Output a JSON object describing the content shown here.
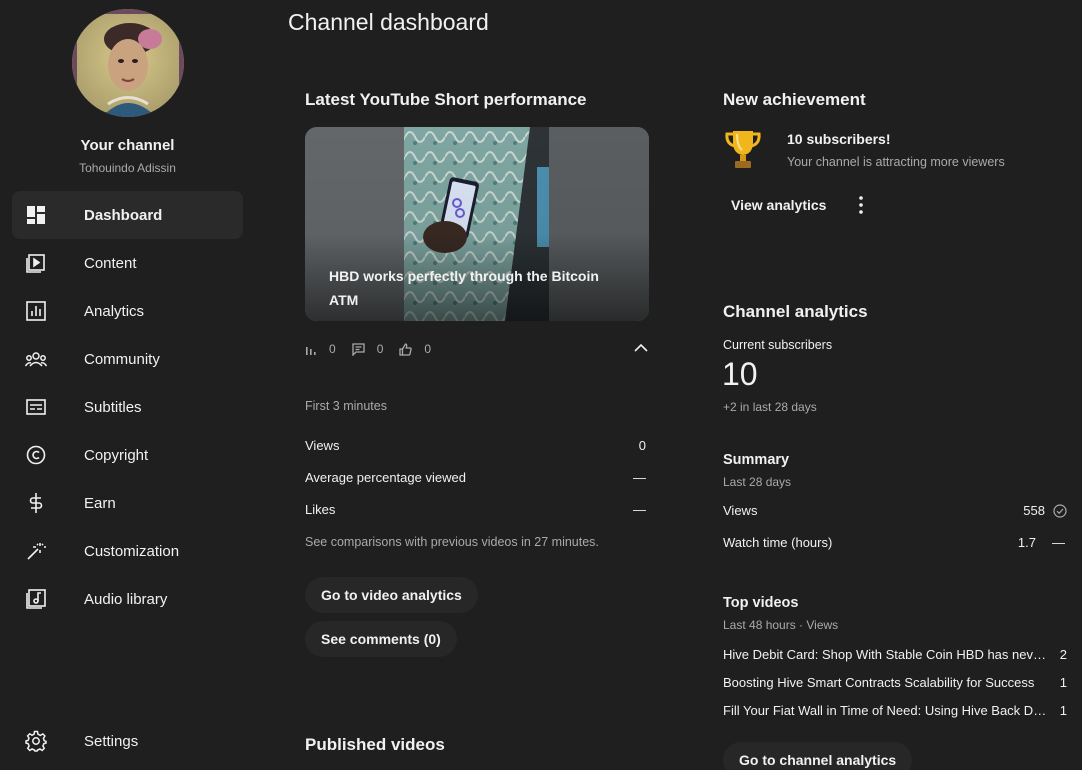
{
  "sidebar": {
    "channel_title": "Your channel",
    "channel_name": "Tohouindo Adissin",
    "items": [
      {
        "label": "Dashboard",
        "icon": "dashboard-icon"
      },
      {
        "label": "Content",
        "icon": "content-icon"
      },
      {
        "label": "Analytics",
        "icon": "analytics-icon"
      },
      {
        "label": "Community",
        "icon": "community-icon"
      },
      {
        "label": "Subtitles",
        "icon": "subtitles-icon"
      },
      {
        "label": "Copyright",
        "icon": "copyright-icon"
      },
      {
        "label": "Earn",
        "icon": "earn-icon"
      },
      {
        "label": "Customization",
        "icon": "customization-icon"
      },
      {
        "label": "Audio library",
        "icon": "audio-library-icon"
      }
    ],
    "settings_label": "Settings"
  },
  "page_title": "Channel dashboard",
  "short": {
    "section_title": "Latest YouTube Short performance",
    "title": "HBD works perfectly through the Bitcoin ATM",
    "views": "0",
    "comments": "0",
    "likes": "0",
    "period": "First 3 minutes",
    "metrics": [
      {
        "label": "Views",
        "value": "0"
      },
      {
        "label": "Average percentage viewed",
        "value": "—"
      },
      {
        "label": "Likes",
        "value": "—"
      }
    ],
    "comparison_note": "See comparisons with previous videos in 27 minutes.",
    "video_analytics_button": "Go to video analytics",
    "comments_button": "See comments (0)"
  },
  "published": {
    "section_title": "Published videos"
  },
  "achievement": {
    "section_title": "New achievement",
    "title": "10 subscribers!",
    "subtitle": "Your channel is attracting more viewers",
    "button": "View analytics"
  },
  "analytics": {
    "section_title": "Channel analytics",
    "subscribers_label": "Current subscribers",
    "subscribers_value": "10",
    "subscribers_change": "+2 in last 28 days",
    "summary_title": "Summary",
    "summary_period": "Last 28 days",
    "summary": [
      {
        "label": "Views",
        "value": "558"
      },
      {
        "label": "Watch time (hours)",
        "value": "1.7"
      }
    ],
    "watch_time_trend": "—",
    "top_videos_title": "Top videos",
    "top_videos_period": "Last 48 hours · Views",
    "top_videos": [
      {
        "title": "Hive Debit Card: Shop With Stable Coin HBD has never been easier",
        "views": "2"
      },
      {
        "title": "Boosting Hive Smart Contracts Scalability for Success",
        "views": "1"
      },
      {
        "title": "Fill Your Fiat Wall in Time of Need: Using Hive Back Dollar",
        "views": "1"
      }
    ],
    "channel_analytics_button": "Go to channel analytics"
  },
  "colors": {
    "background": "#1f1f1f",
    "text": "#f1f1f1",
    "muted": "#aaaaaa",
    "active": "#2a2a2a"
  }
}
